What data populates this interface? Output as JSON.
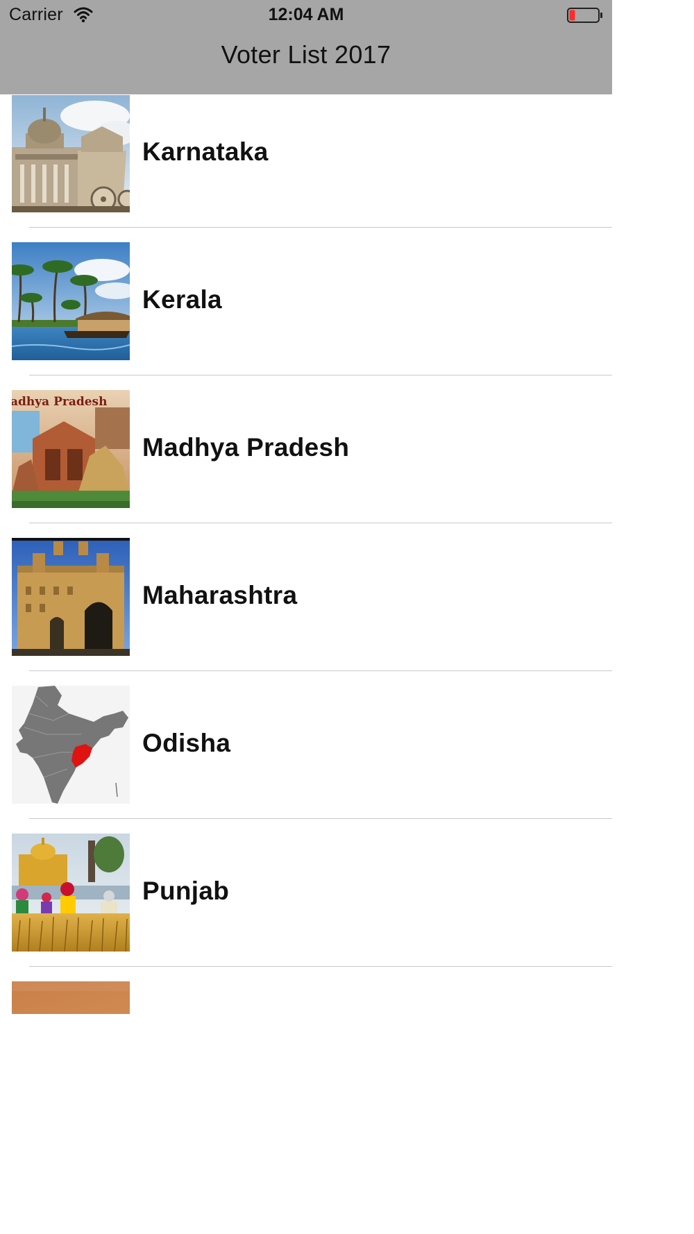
{
  "status_bar": {
    "carrier": "Carrier",
    "time": "12:04 AM",
    "wifi_icon": "wifi-icon",
    "battery_icon": "battery-low-icon"
  },
  "nav": {
    "title": "Voter List 2017",
    "background": "#a6a6a6"
  },
  "states": [
    {
      "name": "Karnataka",
      "thumbnail": "karnataka-vidhana-soudha-image"
    },
    {
      "name": "Kerala",
      "thumbnail": "kerala-backwaters-image"
    },
    {
      "name": "Madhya Pradesh",
      "thumbnail": "madhya-pradesh-temples-image",
      "thumbnail_caption": "adhya Pradesh"
    },
    {
      "name": "Maharashtra",
      "thumbnail": "gateway-of-india-image"
    },
    {
      "name": "Odisha",
      "thumbnail": "india-map-odisha-image"
    },
    {
      "name": "Punjab",
      "thumbnail": "golden-temple-image"
    },
    {
      "name": "",
      "thumbnail": "partial-next-image"
    }
  ]
}
